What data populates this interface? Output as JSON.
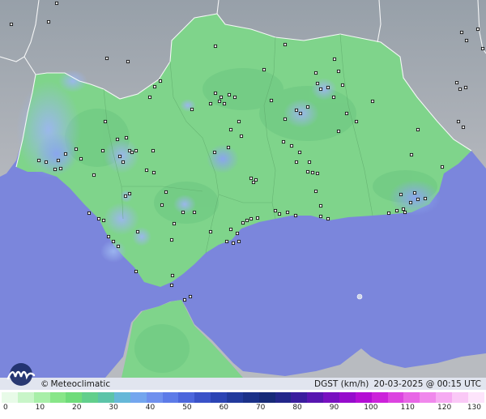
{
  "map": {
    "attribution": "Meteoclimatic",
    "copyright_symbol": "©",
    "variable": "DGST (km/h)",
    "datetime": "20-03-2025 @ 00:15 UTC",
    "colors": {
      "sea": "#7b86dc",
      "land_outside": "#a7a9b0",
      "region_fill": "#7fd48b",
      "gust_blue": "#8fb6e6"
    }
  },
  "legend": {
    "ticks": [
      "0",
      "10",
      "20",
      "30",
      "40",
      "50",
      "60",
      "70",
      "80",
      "90",
      "100",
      "110",
      "120",
      "130"
    ],
    "colors": [
      "#e8fbe8",
      "#c8f5c8",
      "#a8efa8",
      "#88e688",
      "#6fdc7a",
      "#62cf8c",
      "#5cc4a8",
      "#66b8d8",
      "#74a6ee",
      "#6f90ee",
      "#5d7be8",
      "#4c66dc",
      "#3a52c8",
      "#2c44b4",
      "#223a9c",
      "#1b3188",
      "#172a78",
      "#23278a",
      "#3a1d9e",
      "#5716b0",
      "#7810c0",
      "#960ccc",
      "#b40ed4",
      "#cc22da",
      "#dc44e0",
      "#e866e6",
      "#f088ec",
      "#f6aaf2",
      "#fac8f6",
      "#fde4fb"
    ]
  }
}
